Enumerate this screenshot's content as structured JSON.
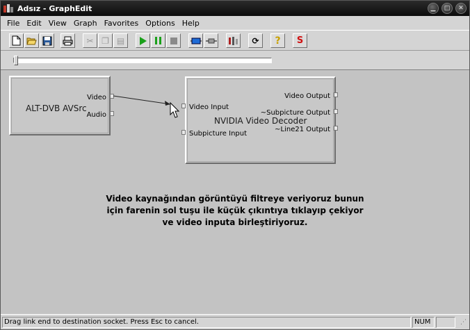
{
  "window": {
    "title": "Adsız - GraphEdit"
  },
  "menu": [
    "File",
    "Edit",
    "View",
    "Graph",
    "Favorites",
    "Options",
    "Help"
  ],
  "toolbar": {
    "buttons": [
      {
        "name": "new-icon",
        "glyph": "🗋"
      },
      {
        "name": "open-icon",
        "glyph": "📂"
      },
      {
        "name": "save-icon",
        "glyph": "💾"
      },
      {
        "name": "print-icon",
        "glyph": "🖶"
      },
      {
        "name": "cut-icon",
        "glyph": "✂"
      },
      {
        "name": "copy-icon",
        "glyph": "❐"
      },
      {
        "name": "paste-icon",
        "glyph": "📋"
      },
      {
        "name": "play-icon",
        "glyph": "▶"
      },
      {
        "name": "pause-icon",
        "glyph": "❚❚"
      },
      {
        "name": "stop-icon",
        "glyph": "■"
      },
      {
        "name": "seek-icon",
        "glyph": "▭"
      },
      {
        "name": "frame-step-icon",
        "glyph": "⊢"
      },
      {
        "name": "filters-icon",
        "glyph": "⚟"
      },
      {
        "name": "refresh-icon",
        "glyph": "⟳"
      },
      {
        "name": "help-icon",
        "glyph": "?"
      },
      {
        "name": "sync-icon",
        "glyph": "S"
      }
    ],
    "colors": {
      "play": "#1aa01a",
      "pause": "#1aa01a",
      "seek": "#1e6bd6",
      "help": "#c8a000",
      "sync": "#d01010"
    }
  },
  "seek": {
    "position": 0
  },
  "filters": {
    "source": {
      "name": "ALT-DVB AVSrc",
      "pins": [
        "Video",
        "Audio"
      ]
    },
    "decoder": {
      "name": "NVIDIA Video Decoder",
      "input_pins": [
        "Video Input",
        "Subpicture Input"
      ],
      "output_pins": [
        "Video Output",
        "~Subpicture Output",
        "~Line21 Output"
      ]
    }
  },
  "annotation": {
    "line1": "Video kaynağından görüntüyü filtreye veriyoruz bunun",
    "line2": "için farenin sol tuşu ile küçük çıkıntıya tıklayıp çekiyor",
    "line3": "ve video inputa birleştiriyoruz."
  },
  "status": {
    "message": "Drag link end to destination socket. Press Esc to cancel.",
    "num": "NUM"
  }
}
